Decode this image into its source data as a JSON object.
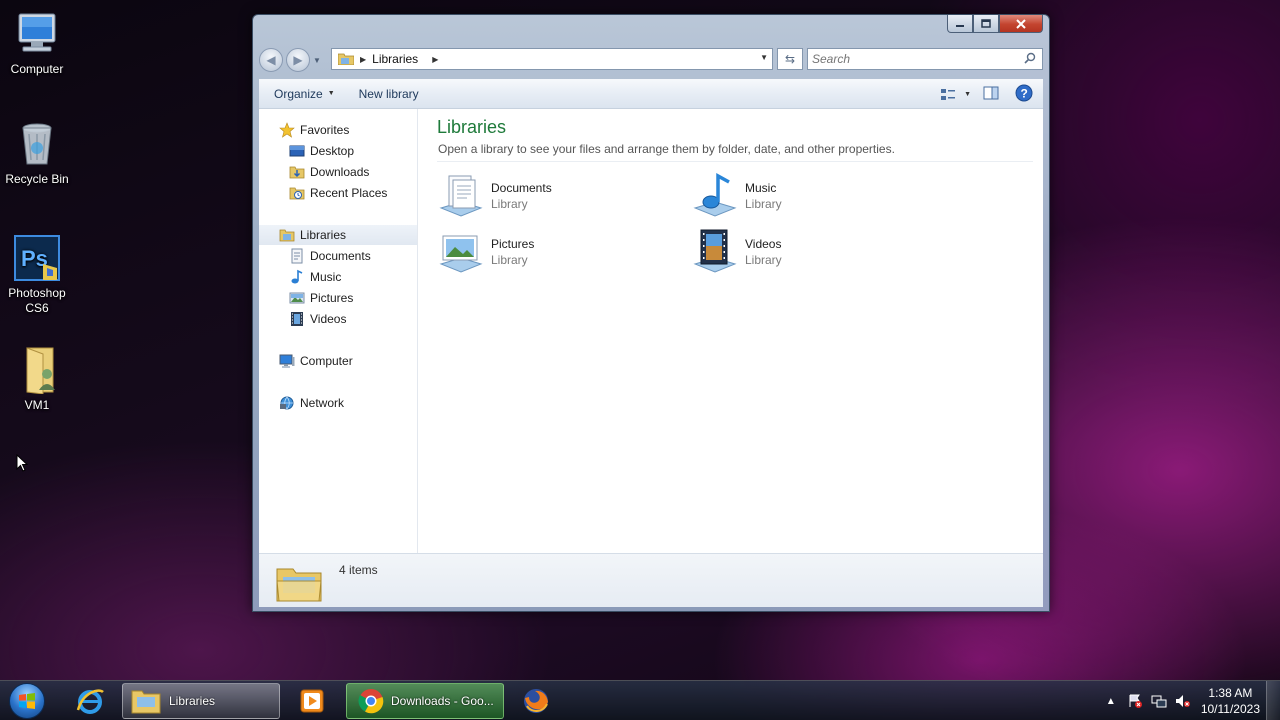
{
  "desktop": {
    "icons": [
      {
        "label": "Computer"
      },
      {
        "label": "Recycle Bin"
      },
      {
        "label": "Photoshop CS6"
      },
      {
        "label": "VM1"
      }
    ]
  },
  "window": {
    "caption_buttons": {
      "minimize": "minimize",
      "maximize": "maximize",
      "close": "close"
    },
    "address": {
      "crumbs": [
        "Libraries"
      ]
    },
    "search": {
      "placeholder": "Search"
    },
    "toolbar": {
      "organize": "Organize",
      "new_library": "New library"
    },
    "nav_pane": {
      "favorites": {
        "label": "Favorites",
        "items": [
          "Desktop",
          "Downloads",
          "Recent Places"
        ]
      },
      "libraries": {
        "label": "Libraries",
        "items": [
          "Documents",
          "Music",
          "Pictures",
          "Videos"
        ]
      },
      "computer": "Computer",
      "network": "Network"
    },
    "main": {
      "title": "Libraries",
      "description": "Open a library to see your files and arrange them by folder, date, and other properties.",
      "libraries": [
        {
          "name": "Documents",
          "type": "Library",
          "icon": "documents-library-icon"
        },
        {
          "name": "Music",
          "type": "Library",
          "icon": "music-library-icon"
        },
        {
          "name": "Pictures",
          "type": "Library",
          "icon": "pictures-library-icon"
        },
        {
          "name": "Videos",
          "type": "Library",
          "icon": "videos-library-icon"
        }
      ]
    },
    "status": {
      "count": "4 items"
    }
  },
  "taskbar": {
    "buttons": [
      {
        "label": "",
        "icon": "internet-explorer-icon"
      },
      {
        "label": "Libraries",
        "icon": "explorer-folder-icon"
      },
      {
        "label": "",
        "icon": "media-player-icon"
      },
      {
        "label": "Downloads - Goo...",
        "icon": "chrome-icon"
      },
      {
        "label": "",
        "icon": "firefox-icon"
      }
    ],
    "clock": {
      "time": "1:38 AM",
      "date": "10/11/2023"
    }
  },
  "colors": {
    "title_green": "#1e7a3a",
    "link_blue": "#1e395b",
    "close_red": "#c3442f"
  }
}
